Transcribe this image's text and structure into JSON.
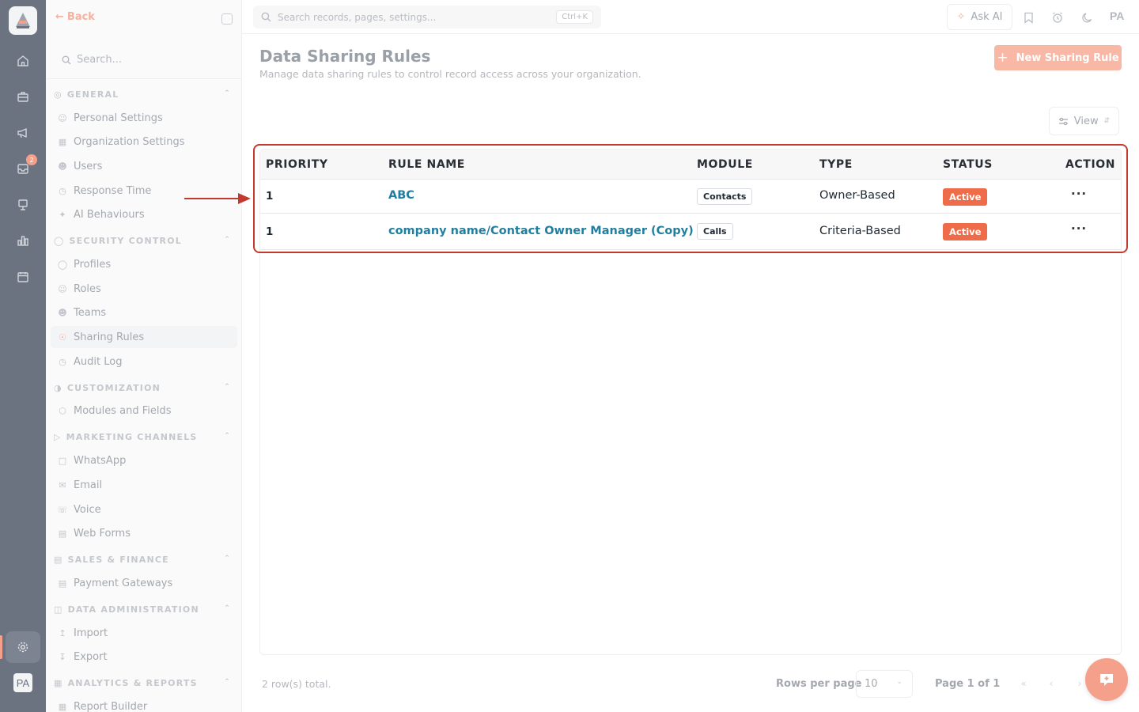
{
  "rail": {
    "items": [
      {
        "name": "home-icon"
      },
      {
        "name": "briefcase-icon"
      },
      {
        "name": "megaphone-icon"
      },
      {
        "name": "inbox-icon",
        "badge": "2"
      },
      {
        "name": "presentation-icon"
      },
      {
        "name": "bar-chart-icon"
      },
      {
        "name": "calendar-icon"
      }
    ],
    "settings_icon": "gear-icon",
    "avatar": "PA"
  },
  "sidebar": {
    "back_label": "Back",
    "search_placeholder": "Search...",
    "sections": [
      {
        "title": "GENERAL",
        "items": [
          "Personal Settings",
          "Organization Settings",
          "Users",
          "Response Time",
          "AI Behaviours"
        ]
      },
      {
        "title": "SECURITY CONTROL",
        "items": [
          "Profiles",
          "Roles",
          "Teams",
          "Sharing Rules",
          "Audit Log"
        ]
      },
      {
        "title": "CUSTOMIZATION",
        "items": [
          "Modules and Fields"
        ]
      },
      {
        "title": "MARKETING CHANNELS",
        "items": [
          "WhatsApp",
          "Email",
          "Voice",
          "Web Forms"
        ]
      },
      {
        "title": "SALES & FINANCE",
        "items": [
          "Payment Gateways"
        ]
      },
      {
        "title": "DATA ADMINISTRATION",
        "items": [
          "Import",
          "Export"
        ]
      },
      {
        "title": "ANALYTICS & REPORTS",
        "items": [
          "Report Builder"
        ]
      }
    ],
    "active_item": "Sharing Rules"
  },
  "topbar": {
    "search_placeholder": "Search records, pages, settings...",
    "shortcut": "Ctrl+K",
    "ask_ai_label": "Ask AI",
    "avatar_initials": "PA"
  },
  "page": {
    "title": "Data Sharing Rules",
    "subtitle": "Manage data sharing rules to control record access across your organization.",
    "new_button_label": "New Sharing Rule",
    "view_button_label": "View"
  },
  "table": {
    "columns": [
      "PRIORITY",
      "RULE NAME",
      "MODULE",
      "TYPE",
      "STATUS",
      "ACTION"
    ],
    "rows": [
      {
        "priority": "1",
        "rule_name": "ABC",
        "module": "Contacts",
        "type": "Owner-Based",
        "status": "Active",
        "action": "···"
      },
      {
        "priority": "1",
        "rule_name": "company name/Contact Owner Manager (Copy)",
        "module": "Calls",
        "type": "Criteria-Based",
        "status": "Active",
        "action": "···"
      }
    ]
  },
  "footer": {
    "total_text": "2 row(s) total.",
    "rows_per_page_label": "Rows per page",
    "rows_per_page_value": "10",
    "page_text": "Page 1 of 1"
  },
  "colors": {
    "accent": "#f9b8a6",
    "status_active": "#ef6c4a",
    "link": "#1f7fa0",
    "highlight": "#c23a2f"
  }
}
